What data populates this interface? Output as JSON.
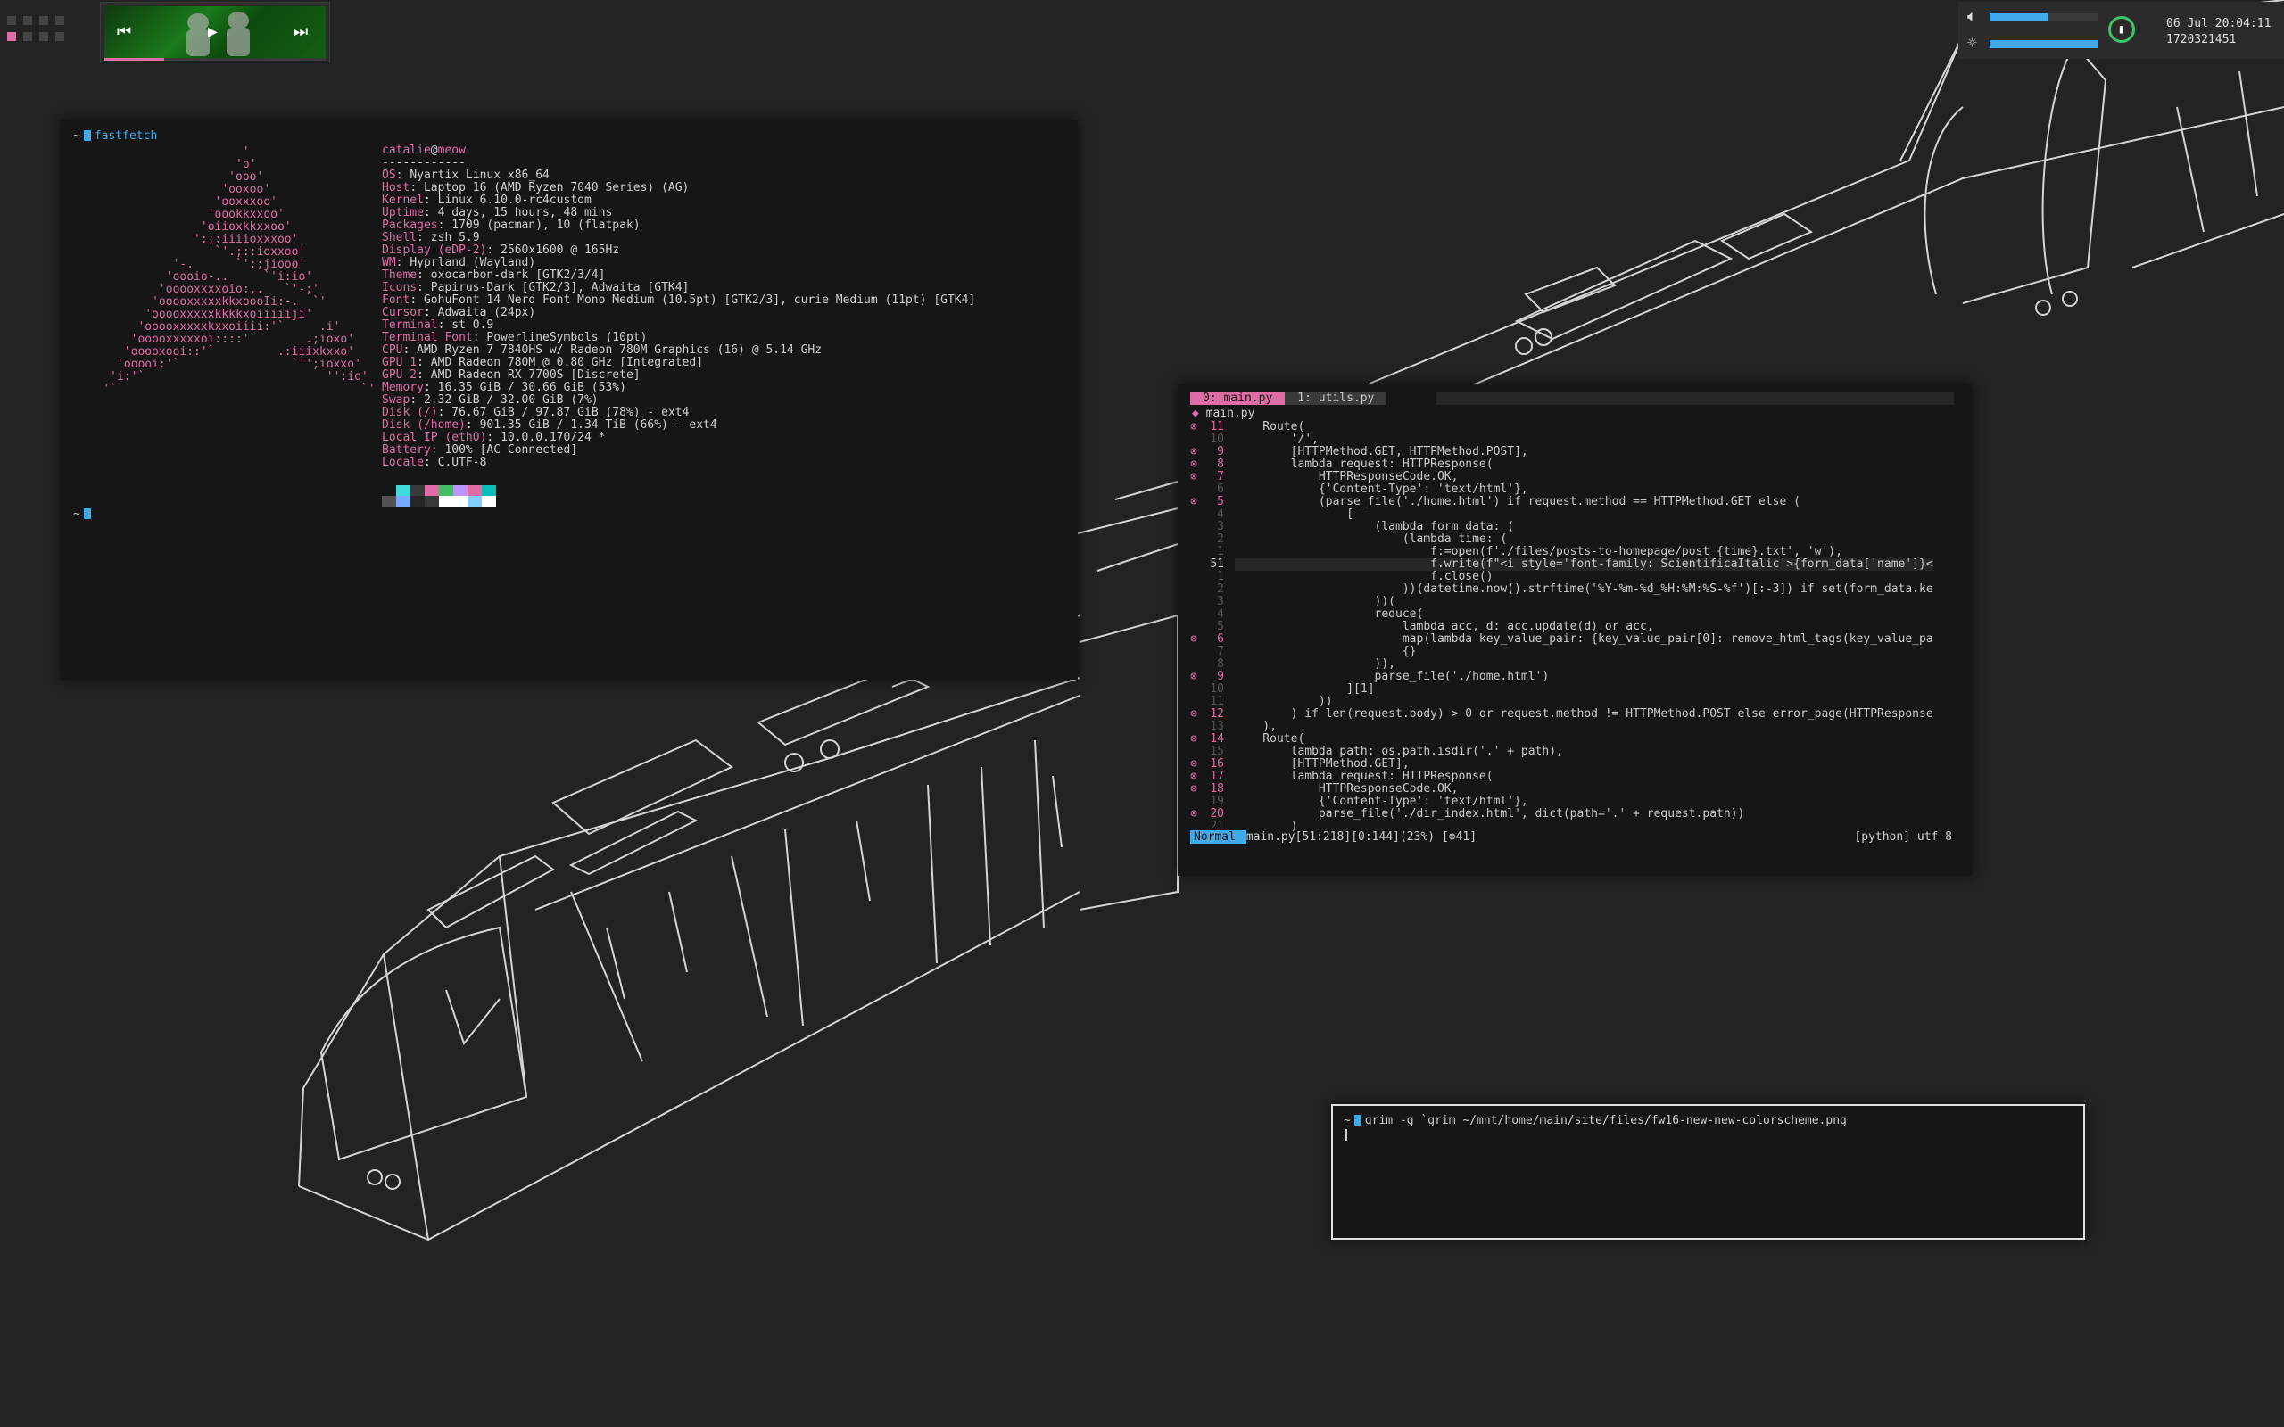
{
  "workspaces": {
    "count": 8,
    "active_index": 4
  },
  "media": {
    "prev_icon": "⏮",
    "play_icon": "▶",
    "next_icon": "⏭",
    "progress": 0.27
  },
  "status": {
    "volume_level": 0.53,
    "brightness_level": 1.0,
    "clock_date": "06 Jul 20:04:11",
    "clock_epoch": "1720321451",
    "colors": {
      "accent": "#42aaea",
      "battery": "#3dc468",
      "pink": "#e06ca5"
    }
  },
  "fetch": {
    "prompt_cmd": "fastfetch",
    "logo": [
      "                        '",
      "                       'o'",
      "                      'ooo'",
      "                     'ooxoo'",
      "                    'ooxxxoo'",
      "                   'oookkxxoo'",
      "                  'oiioxkkxxoo'",
      "                 ':;:iiiioxxxoo'",
      "                    `'.;::ioxxoo'",
      "              '-.      `':;jiooo'",
      "             'oooio-..     `'i:io'",
      "            'ooooxxxxoio:,.   `'-;'",
      "           'ooooxxxxxkkxoooIi:-.  `'",
      "          'ooooxxxxxkkkkxoiiiiiji'",
      "         'ooooxxxxxkxxoiiii:'`     .i'",
      "        'ooooxxxxxoi::::'`       .;ioxo'",
      "       'ooooxooi::'`         .:iiixkxxo'",
      "      'ooooi:'`                `'';ioxxo'",
      "     'i:'`                          '':io'",
      "    '`                                   `'"
    ],
    "header_user": "catalie",
    "header_at": "@",
    "header_host": "meow",
    "separator": "------------",
    "info": [
      {
        "k": "OS",
        "v": "Nyartix Linux x86_64"
      },
      {
        "k": "Host",
        "v": "Laptop 16 (AMD Ryzen 7040 Series) (AG)"
      },
      {
        "k": "Kernel",
        "v": "Linux 6.10.0-rc4custom"
      },
      {
        "k": "Uptime",
        "v": "4 days, 15 hours, 48 mins"
      },
      {
        "k": "Packages",
        "v": "1709 (pacman), 10 (flatpak)"
      },
      {
        "k": "Shell",
        "v": "zsh 5.9"
      },
      {
        "k": "Display (eDP-2)",
        "v": "2560x1600 @ 165Hz"
      },
      {
        "k": "WM",
        "v": "Hyprland (Wayland)"
      },
      {
        "k": "Theme",
        "v": "oxocarbon-dark [GTK2/3/4]"
      },
      {
        "k": "Icons",
        "v": "Papirus-Dark [GTK2/3], Adwaita [GTK4]"
      },
      {
        "k": "Font",
        "v": "GohuFont 14 Nerd Font Mono Medium (10.5pt) [GTK2/3], curie Medium (11pt) [GTK4]"
      },
      {
        "k": "Cursor",
        "v": "Adwaita (24px)"
      },
      {
        "k": "Terminal",
        "v": "st 0.9"
      },
      {
        "k": "Terminal Font",
        "v": "PowerlineSymbols (10pt)"
      },
      {
        "k": "CPU",
        "v": "AMD Ryzen 7 7840HS w/ Radeon 780M Graphics (16) @ 5.14 GHz"
      },
      {
        "k": "GPU 1",
        "v": "AMD Radeon 780M @ 0.80 GHz [Integrated]"
      },
      {
        "k": "GPU 2",
        "v": "AMD Radeon RX 7700S [Discrete]"
      },
      {
        "k": "Memory",
        "v": "16.35 GiB / 30.66 GiB (53%)"
      },
      {
        "k": "Swap",
        "v": "2.32 GiB / 32.00 GiB (7%)"
      },
      {
        "k": "Disk (/)",
        "v": "76.67 GiB / 97.87 GiB (78%) - ext4"
      },
      {
        "k": "Disk (/home)",
        "v": "901.35 GiB / 1.34 TiB (66%) - ext4"
      },
      {
        "k": "Local IP (eth0)",
        "v": "10.0.0.170/24 *"
      },
      {
        "k": "Battery",
        "v": "100% [AC Connected]"
      },
      {
        "k": "Locale",
        "v": "C.UTF-8"
      }
    ],
    "palette_top": [
      "#161616",
      "#3ddbd9",
      "#393939",
      "#e06ca5",
      "#42be65",
      "#be95ff",
      "#e06ca5",
      "#08bdba"
    ],
    "palette_bottom": [
      "#525252",
      "#78a9ff",
      "#262626",
      "#393939",
      "#ffffff",
      "#ffffff",
      "#82cfff",
      "#ffffff"
    ]
  },
  "editor": {
    "tab_active": " 0:  main.py ",
    "tab_inactive": " 1:  utils.py ",
    "filename": "main.py",
    "lines": [
      {
        "s": "⊗",
        "n": "11",
        "t": "    Route("
      },
      {
        "s": "",
        "n": "10",
        "t": "        '/',"
      },
      {
        "s": "⊗",
        "n": "9",
        "t": "        [HTTPMethod.GET, HTTPMethod.POST],"
      },
      {
        "s": "⊗",
        "n": "8",
        "t": "        lambda request: HTTPResponse("
      },
      {
        "s": "⊗",
        "n": "7",
        "t": "            HTTPResponseCode.OK,"
      },
      {
        "s": "",
        "n": "6",
        "t": "            {'Content-Type': 'text/html'},"
      },
      {
        "s": "⊗",
        "n": "5",
        "t": "            (parse_file('./home.html') if request.method == HTTPMethod.GET else ("
      },
      {
        "s": "",
        "n": "4",
        "t": "                ["
      },
      {
        "s": "",
        "n": "3",
        "t": "                    (lambda form_data: ("
      },
      {
        "s": "",
        "n": "2",
        "t": "                        (lambda time: ("
      },
      {
        "s": "",
        "n": "1",
        "t": "                            f:=open(f'./files/posts-to-homepage/post_{time}.txt', 'w'),"
      },
      {
        "s": "",
        "n": "51",
        "t": "                            f.write(f\"<i style='font-family: ScientificaItalic'>{form_data['name']}<",
        "cur": true
      },
      {
        "s": "",
        "n": "1",
        "t": "                            f.close()"
      },
      {
        "s": "",
        "n": "2",
        "t": "                        ))(datetime.now().strftime('%Y-%m-%d_%H:%M:%S-%f')[:-3]) if set(form_data.ke"
      },
      {
        "s": "",
        "n": "3",
        "t": "                    ))("
      },
      {
        "s": "",
        "n": "4",
        "t": "                    reduce("
      },
      {
        "s": "",
        "n": "5",
        "t": "                        lambda acc, d: acc.update(d) or acc,"
      },
      {
        "s": "⊗",
        "n": "6",
        "t": "                        map(lambda key_value_pair: {key_value_pair[0]: remove_html_tags(key_value_pa"
      },
      {
        "s": "",
        "n": "7",
        "t": "                        {}"
      },
      {
        "s": "",
        "n": "8",
        "t": "                    )),"
      },
      {
        "s": "⊗",
        "n": "9",
        "t": "                    parse_file('./home.html')"
      },
      {
        "s": "",
        "n": "10",
        "t": "                ][1]"
      },
      {
        "s": "",
        "n": "11",
        "t": "            ))"
      },
      {
        "s": "⊗",
        "n": "12",
        "t": "        ) if len(request.body) > 0 or request.method != HTTPMethod.POST else error_page(HTTPResponse"
      },
      {
        "s": "",
        "n": "13",
        "t": "    ),"
      },
      {
        "s": "⊗",
        "n": "14",
        "t": "    Route("
      },
      {
        "s": "",
        "n": "15",
        "t": "        lambda path: os.path.isdir('.' + path),"
      },
      {
        "s": "⊗",
        "n": "16",
        "t": "        [HTTPMethod.GET],"
      },
      {
        "s": "⊗",
        "n": "17",
        "t": "        lambda request: HTTPResponse("
      },
      {
        "s": "⊗",
        "n": "18",
        "t": "            HTTPResponseCode.OK,"
      },
      {
        "s": "",
        "n": "19",
        "t": "            {'Content-Type': 'text/html'},"
      },
      {
        "s": "⊗",
        "n": "20",
        "t": "            parse_file('./dir_index.html', dict(path='.' + request.path))"
      },
      {
        "s": "",
        "n": "21",
        "t": "        )"
      }
    ],
    "mode": " Normal ",
    "position": "main.py[51:218][0:144](23%) [⊗41]",
    "filetype": "[python] utf-8"
  },
  "grim": {
    "prompt": "~",
    "command": "grim -g `grim ~/mnt/home/main/site/files/fw16-new-new-colorscheme.png"
  }
}
